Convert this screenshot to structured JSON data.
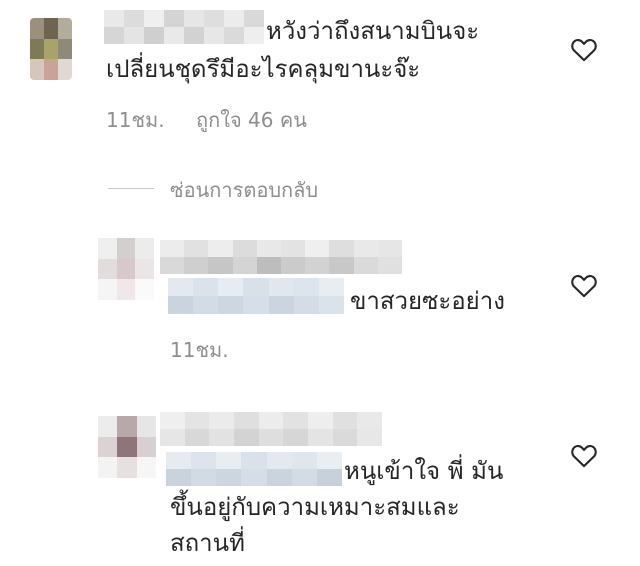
{
  "comments": [
    {
      "text_lines": [
        "หวังว่าถึงสนามบินจะ",
        "เปลี่ยนชุดรึมีอะไรคลุมขานะจ๊ะ"
      ],
      "time": "11ชม.",
      "likes": "ถูกใจ 46 คน",
      "hide_replies": "ซ่อนการตอบกลับ"
    },
    {
      "text_lines": [
        "ขาสวยซะอย่าง"
      ],
      "time": "11ชม."
    },
    {
      "text_lines": [
        "หนูเข้าใจ พี่ มัน",
        "ขึ้นอยู่กับความเหมาะสมและ",
        "สถานที่"
      ]
    }
  ],
  "icons": {
    "like": "heart-outline-icon"
  },
  "colors": {
    "text": "#262626",
    "muted": "#8e8e8e",
    "divider": "#c7c7c7"
  }
}
